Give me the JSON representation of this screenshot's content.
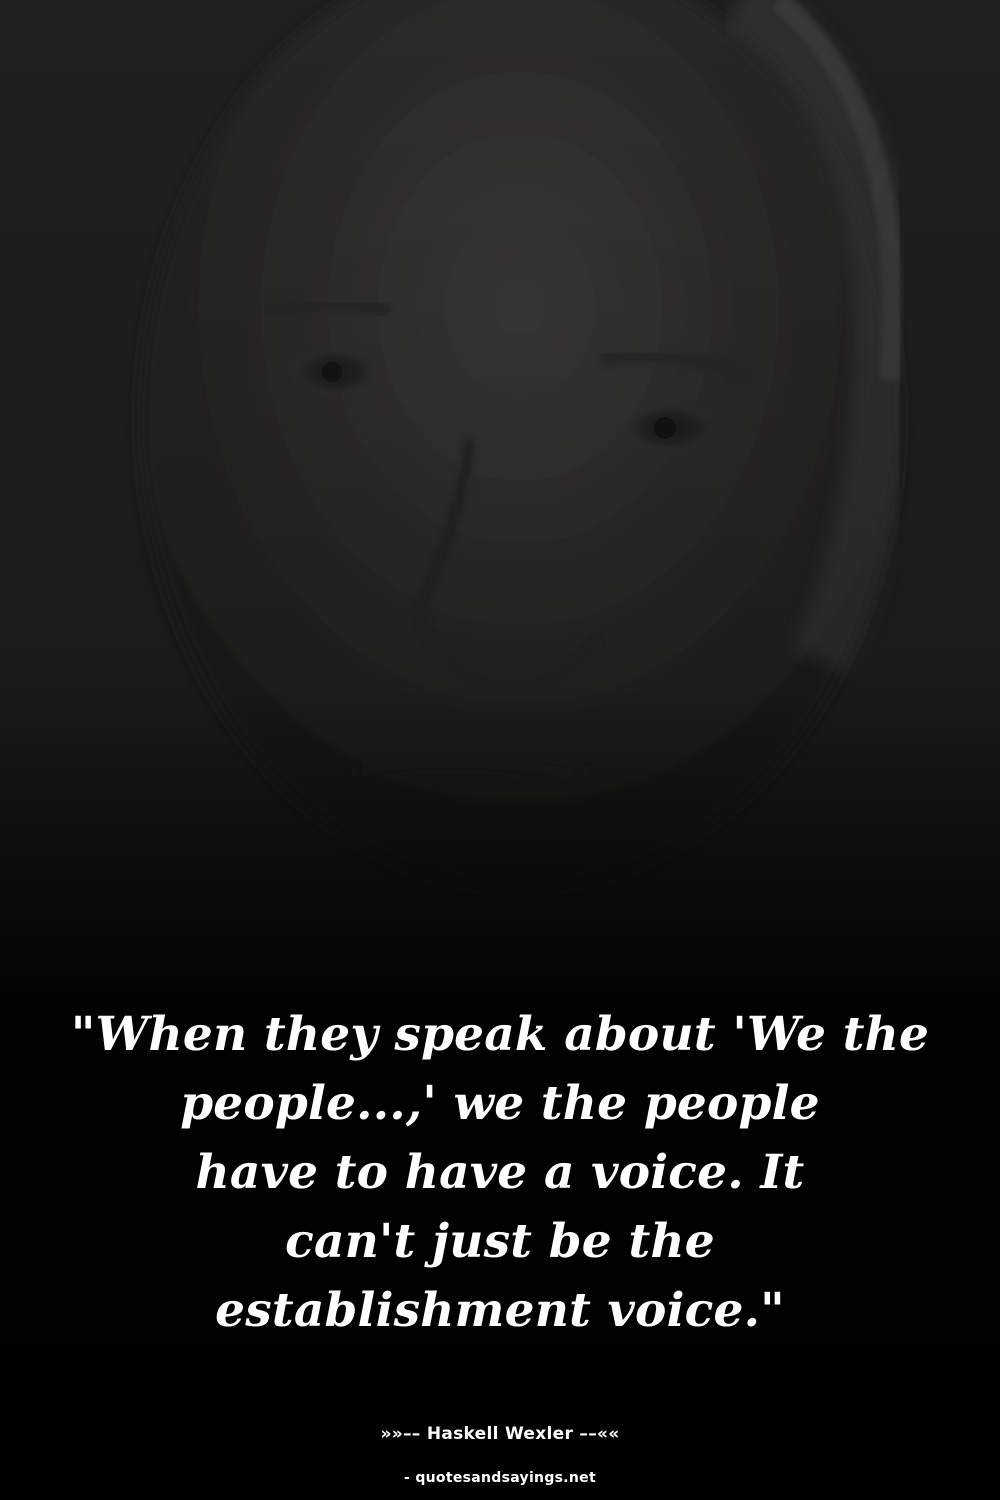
{
  "quote": {
    "lines": [
      "\"When they speak about 'We the",
      "people...,' we the people",
      "have to have a voice. It",
      "can't just be the",
      "establishment voice.\""
    ]
  },
  "attribution": {
    "author_line": "»»–– Haskell Wexler ––««",
    "source": "- quotesandsayings.net"
  },
  "colors": {
    "background": "#0b0b0b",
    "text": "#ffffff"
  }
}
